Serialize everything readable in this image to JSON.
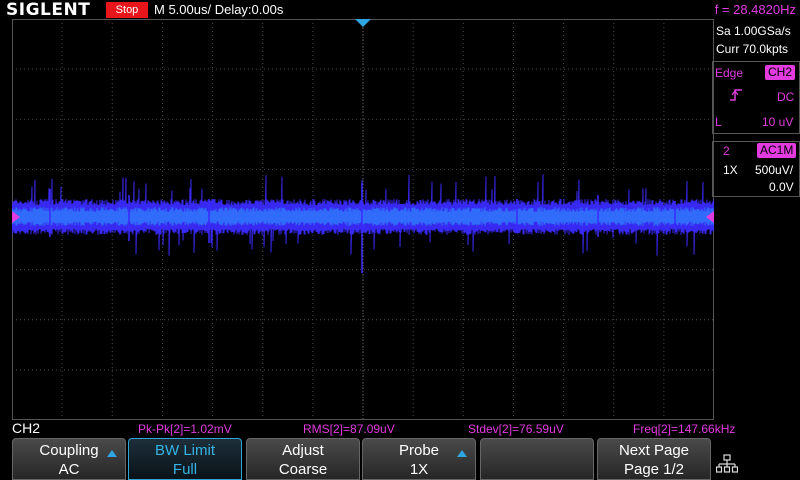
{
  "topbar": {
    "logo": "SIGLENT",
    "run_state": "Stop",
    "timebase": "M 5.00us/  Delay:0.00s",
    "counter": "f = 28.4820Hz"
  },
  "acquisition": {
    "sample_rate": "Sa 1.00GSa/s",
    "memory": "Curr 70.0kpts"
  },
  "trigger": {
    "type": "Edge",
    "source": "CH2",
    "coupling": "DC",
    "level_label": "L",
    "level": "10 uV"
  },
  "channel": {
    "number": "2",
    "impedance_badge": "AC1M",
    "probe": "1X",
    "scale": "500uV/",
    "offset": "0.0V"
  },
  "status": {
    "channel": "CH2",
    "measurements": [
      "Pk-Pk[2]=1.02mV",
      "RMS[2]=87.09uV",
      "Stdev[2]=76.59uV",
      "Freq[2]=147.66kHz"
    ]
  },
  "softkeys": [
    {
      "title": "Coupling",
      "value": "AC",
      "arrow": true,
      "active": false
    },
    {
      "title": "BW Limit",
      "value": "Full",
      "arrow": false,
      "active": true
    },
    {
      "title": "Adjust",
      "value": "Coarse",
      "arrow": false,
      "active": false
    },
    {
      "title": "Probe",
      "value": "1X",
      "arrow": true,
      "active": false
    },
    {
      "title": "",
      "value": "",
      "arrow": false,
      "active": false
    },
    {
      "title": "Next Page",
      "value": "Page 1/2",
      "arrow": false,
      "active": false
    }
  ],
  "colors": {
    "accent": "#e23be0",
    "trace": "#3b2bff",
    "trace_core": "#2aa4ff",
    "trigger_marker": "#2fa6e2",
    "stop": "#e8161b"
  },
  "icons": {
    "network": "network-icon",
    "trigger_edge": "rising-edge-icon"
  }
}
